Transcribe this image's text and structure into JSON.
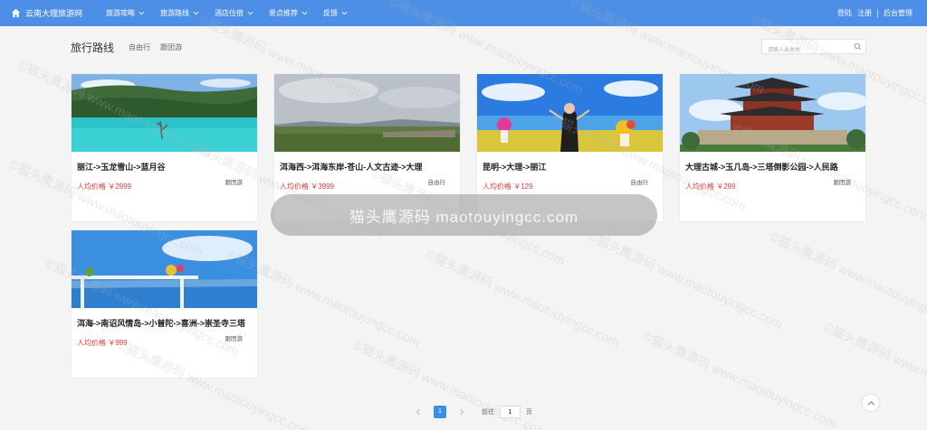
{
  "brand": {
    "name": "云南大理旅游网"
  },
  "nav": {
    "items": [
      {
        "label": "旅游攻略"
      },
      {
        "label": "旅游路线"
      },
      {
        "label": "酒店住宿"
      },
      {
        "label": "景点推荐"
      },
      {
        "label": "反馈"
      }
    ]
  },
  "user_links": {
    "login": "登陆",
    "register": "注册",
    "admin": "后台管理"
  },
  "section": {
    "title": "旅行路线",
    "filters": [
      "自由行",
      "跟团游"
    ]
  },
  "search": {
    "placeholder": "请输入出发地"
  },
  "cards": [
    {
      "title": "丽江->玉龙雪山->蓝月谷",
      "price": "人均价格 ￥2999",
      "tag": "跟团游",
      "image": "lake-forest"
    },
    {
      "title": "洱海西->洱海东岸-苍山-人文古迹->大理",
      "price": "人均价格 ￥3999",
      "tag": "自由行",
      "image": "erhai-fields"
    },
    {
      "title": "昆明->大理->丽江",
      "price": "人均价格 ￥129",
      "tag": "自由行",
      "image": "girl-flowers-sea"
    },
    {
      "title": "大理古城->玉几岛->三塔倒影公园->人民路",
      "price": "人均价格 ￥299",
      "tag": "跟团游",
      "image": "ancient-tower"
    },
    {
      "title": "洱海->南诏风情岛->小普陀->喜洲->崇圣寺三塔",
      "price": "人均价格 ￥999",
      "tag": "跟团游",
      "image": "lakeside-pergola"
    }
  ],
  "pagination": {
    "current": "1",
    "goto_label": "前往",
    "page_value": "1",
    "page_suffix": "页"
  },
  "watermark": {
    "banner": "猫头鹰源码 maotouyingcc.com",
    "text": "©猫头鹰源码 www.maotouyingcc.com"
  },
  "colors": {
    "nav_bg": "#4d8fe6",
    "price": "#e03a3a",
    "page_active": "#3a8ee6"
  }
}
